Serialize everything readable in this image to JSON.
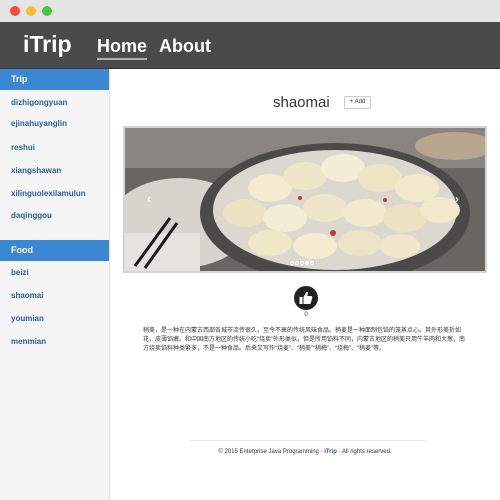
{
  "navbar": {
    "brand": "iTrip",
    "links": [
      "Home",
      "About"
    ]
  },
  "sidebar": {
    "trip_header": "Trip",
    "trip_items": [
      "dizhigongyuan",
      "ejinahuyanglin",
      "reshui",
      "xiangshawan",
      "xilinguolexilamulun",
      "daqinggou"
    ],
    "food_header": "Food",
    "food_items": [
      "beizi",
      "shaomai",
      "youmian",
      "menmian"
    ]
  },
  "main": {
    "title": "shaomai",
    "add_button": "+ Add",
    "carousel": {
      "prev_icon": "chevron-left-icon",
      "next_icon": "chevron-right-icon",
      "slide_count": 5,
      "active_index": 3
    },
    "likes": {
      "icon": "thumbs-up-icon",
      "count": "0"
    },
    "description": "稍美，是一种在内蒙古西部各城市流传很久，至今不衰的传统风味食品。稍麦是一种面制包馅的笼蒸点心。其外形美折如花，皮薄馅嫩。和中国南方地区的传统小吃“烧卖”外形类似，但是所用馅料不同，内蒙古地区的稍美只用牛羊肉和大葱，南方烧卖馅料种类繁多，不是一种食品。后来又写作“烧麦”、“稍美”“稍梅”、“烧梅”、“稍麦”等。"
  },
  "footer": {
    "prefix": "© 2015 Enterprise Java Programming · ",
    "brand": "iTrip",
    "suffix": " · All rights reserved."
  }
}
